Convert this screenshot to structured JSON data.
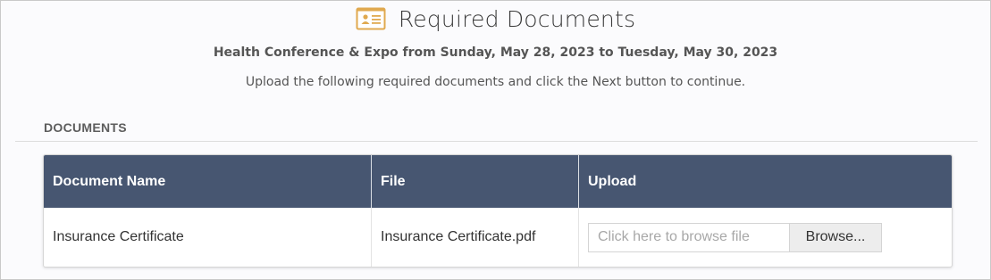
{
  "header": {
    "icon": "id-card-icon",
    "title": "Required Documents"
  },
  "event": {
    "line": "Health Conference & Expo from Sunday, May 28, 2023 to Tuesday, May 30, 2023"
  },
  "instructions": "Upload the following required documents and click the Next button to continue.",
  "section": {
    "heading": "DOCUMENTS"
  },
  "table": {
    "columns": [
      "Document Name",
      "File",
      "Upload"
    ],
    "rows": [
      {
        "document_name": "Insurance Certificate",
        "file": "Insurance Certificate.pdf",
        "upload_placeholder": "Click here to browse file",
        "browse_label": "Browse..."
      }
    ]
  },
  "colors": {
    "header_bg": "#475671",
    "icon_accent": "#e0a94f"
  }
}
